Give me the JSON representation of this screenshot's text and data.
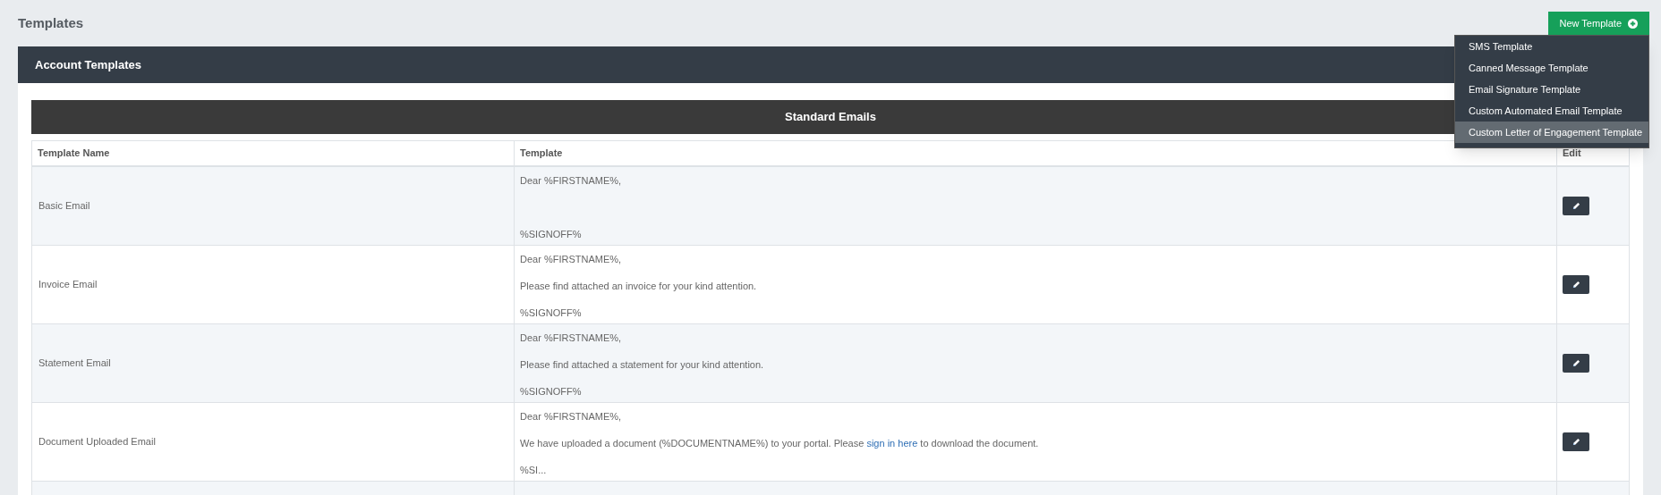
{
  "page_title": "Templates",
  "new_button": {
    "label": "New Template",
    "expanded": true
  },
  "menu": [
    {
      "label": "SMS Template",
      "selected": false
    },
    {
      "label": "Canned Message Template",
      "selected": false
    },
    {
      "label": "Email Signature Template",
      "selected": false
    },
    {
      "label": "Custom Automated Email Template",
      "selected": false
    },
    {
      "label": "Custom Letter of Engagement Template",
      "selected": true
    }
  ],
  "panel": {
    "title": "Account Templates"
  },
  "section": {
    "title": "Standard Emails"
  },
  "table": {
    "columns": [
      "Template Name",
      "Template",
      "Edit"
    ],
    "rows": [
      {
        "name": "Basic Email",
        "greeting": "Dear %FIRSTNAME%,",
        "signoff": "%SIGNOFF%"
      },
      {
        "name": "Invoice Email",
        "greeting": "Dear %FIRSTNAME%,",
        "body": [
          {
            "text": "Please find attached an invoice for your kind attention."
          }
        ],
        "signoff": "%SIGNOFF%"
      },
      {
        "name": "Statement Email",
        "greeting": "Dear %FIRSTNAME%,",
        "body": [
          {
            "text": "Please find attached a statement for your kind attention."
          }
        ],
        "signoff": "%SIGNOFF%"
      },
      {
        "name": "Document Uploaded Email",
        "greeting": "Dear %FIRSTNAME%,",
        "body": [
          {
            "text": "We have uploaded a document (%DOCUMENTNAME%) to your portal. Please "
          },
          {
            "text": "sign in here",
            "kind": "link"
          },
          {
            "text": " to download the document."
          }
        ],
        "signoff": "%SI..."
      }
    ]
  }
}
